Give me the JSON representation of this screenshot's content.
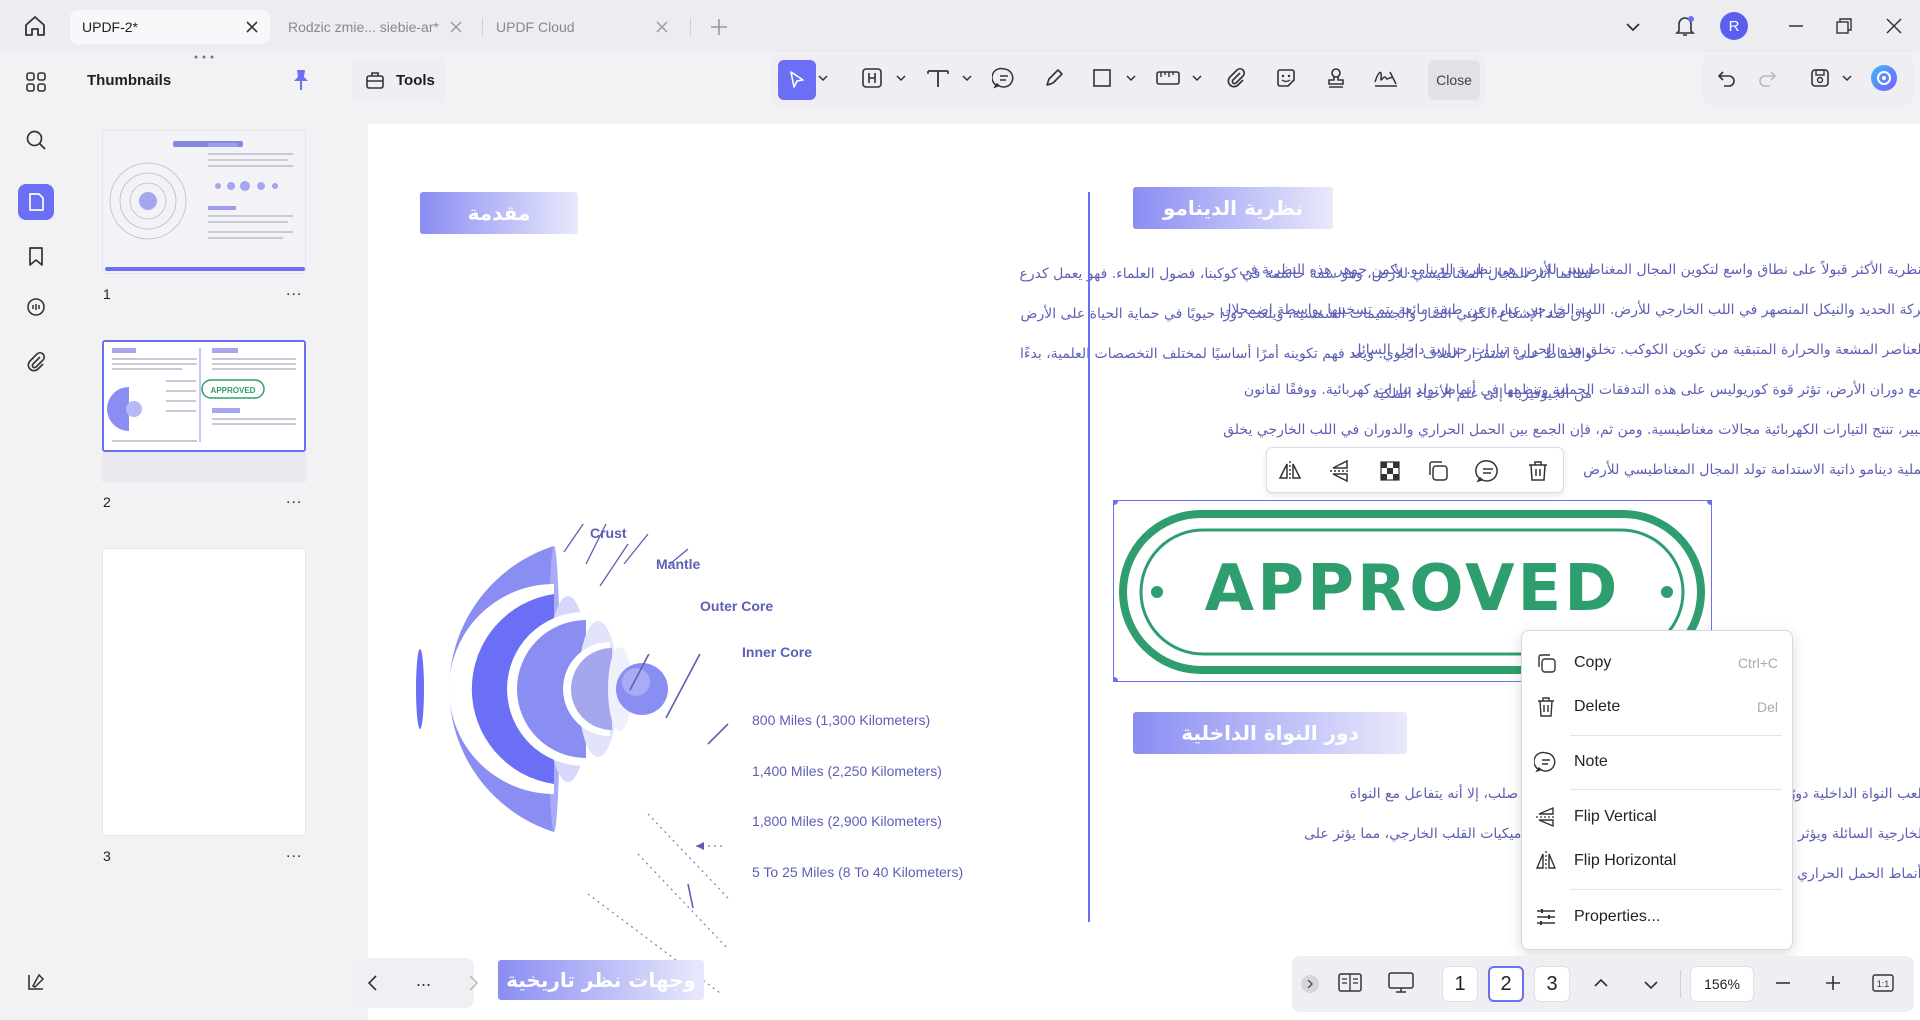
{
  "tabs": [
    {
      "label": "UPDF-2*",
      "active": true
    },
    {
      "label": "Rodzic zmie... siebie-ar*",
      "active": false
    },
    {
      "label": "UPDF Cloud",
      "active": false
    }
  ],
  "user": {
    "avatar_letter": "R"
  },
  "panel": {
    "title": "Thumbnails"
  },
  "thumbnails": [
    {
      "number": "1"
    },
    {
      "number": "2"
    },
    {
      "number": "3"
    }
  ],
  "thumb_more": "...",
  "toolbar": {
    "tools_label": "Tools",
    "close_label": "Close"
  },
  "document": {
    "intro_heading": "مقدمة",
    "intro_lines": [
      "لطالما أثار المجال المغناطيسي للأرض، وهو سمة حاسمة في كوكبنا، فضول العلماء. فهو يعمل كدرع",
      "واق ضد الإشعاع الكوني الضار والجسيمات الشمسية، ويلعب دورًا حيويًا في حماية الحياة على الأرض",
      "والحفاظ على استقرار الغلاف الجوي. ويعد فهم تكوينه أمرًا أساسيًا لمختلف التخصصات العلمية، بدءًا",
      "من الجيوفيزياء إلى علم الأحياء الفلكية"
    ],
    "layers": {
      "crust": "Crust",
      "mantle": "Mantle",
      "outer_core": "Outer Core",
      "inner_core": "Inner Core"
    },
    "distances": [
      "800 Miles (1,300 Kilometers)",
      "1,400 Miles (2,250 Kilometers)",
      "1,800 Miles (2,900 Kilometers)",
      "5 To 25 Miles (8 To 40 Kilometers)"
    ],
    "dynamo_heading": "نظرية الدينامو",
    "dynamo_lines": [
      "النظرية الأكثر قبولاً على نطاق واسع لتكوين المجال المغناطيسي للأرض هي نظرية الدينامو. يكمن جوهر هذه النظرية في",
      "حركة الحديد والنيكل المنصهر في اللب الخارجي للأرض. اللب الخارجي عبارة عن طبقة مائعة يتم تسخينها بواسطة اضمحلال",
      ".العناصر المشعة والحرارة المتبقية من تكوين الكوكب. تخلق هذه الحرارة تيارات حرارية داخل السائل",
      "ومع دوران الأرض، تؤثر قوة كوريوليس على هذه التدفقات الحملية وتنظمها في أنماط تولد تيارات كهربائية. ووفقًا لقانون",
      "أمبير، تنتج التيارات الكهربائية مجالات مغناطيسية. ومن ثم، فإن الجمع بين الحمل الحراري والدوران في اللب الخارجي يخلق",
      "عملية دينامو ذاتية الاستدامة تولد المجال المغناطيسي للأرض"
    ],
    "stamp_text": "APPROVED",
    "core_heading": "دور النواة الداخلية",
    "core_lines": [
      "يلعب النواة الداخلية دورًا في المجال المغناطيسي. وعلى الرغم من أنه صلب، إلا أنه يتفاعل مع النواة",
      "الخارجية السائلة ويؤثر على حركة السوائل في القلب الداخلي على ديناميكيات القلب الخارجي، مما يؤثر على",
      ".أنماط الحمل الحراري"
    ],
    "historic_heading": "وجهات نظر تاريخية"
  },
  "context_menu": {
    "copy": {
      "label": "Copy",
      "shortcut": "Ctrl+C"
    },
    "delete": {
      "label": "Delete",
      "shortcut": "Del"
    },
    "note": {
      "label": "Note"
    },
    "flip_vertical": {
      "label": "Flip Vertical"
    },
    "flip_horizontal": {
      "label": "Flip Horizontal"
    },
    "properties": {
      "label": "Properties..."
    }
  },
  "bottom_left": {
    "more": "..."
  },
  "pagination": {
    "pages": [
      "1",
      "2",
      "3"
    ],
    "current": "2",
    "zoom": "156%"
  },
  "colors": {
    "accent": "#6b6ff5",
    "stamp_green": "#2f9e6e",
    "doc_text": "#5d5fb4"
  }
}
